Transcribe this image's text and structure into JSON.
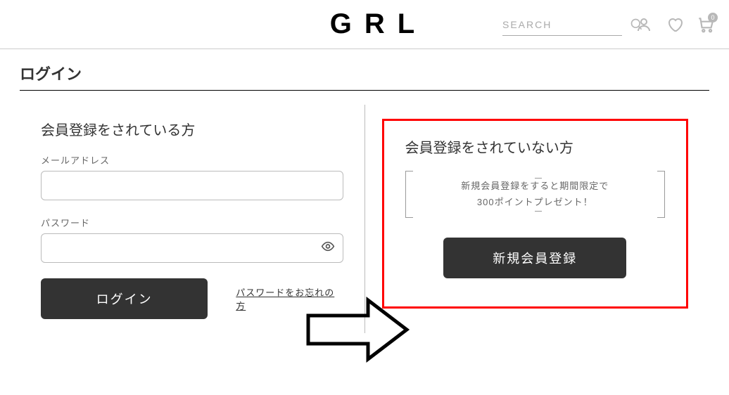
{
  "header": {
    "logo": "GRL",
    "search_placeholder": "SEARCH",
    "cart_count": "0"
  },
  "page_title": "ログイン",
  "left": {
    "title": "会員登録をされている方",
    "email_label": "メールアドレス",
    "password_label": "パスワード",
    "login_button": "ログイン",
    "forgot_link": "パスワードをお忘れの方"
  },
  "right": {
    "title": "会員登録をされていない方",
    "promo_line1": "新規会員登録をすると期間限定で",
    "promo_line2": "300ポイントプレゼント！",
    "register_button": "新規会員登録"
  }
}
